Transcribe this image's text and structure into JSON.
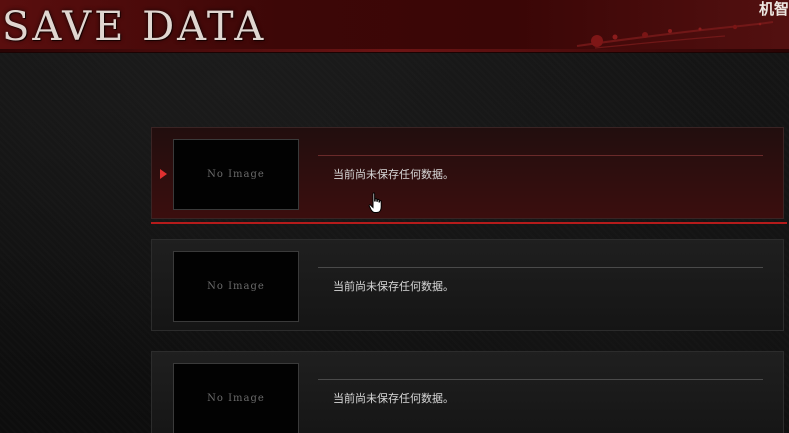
{
  "header": {
    "title": "SAVE DATA",
    "corner_text": "机智"
  },
  "slots": [
    {
      "thumbnail_label": "No Image",
      "status": "当前尚未保存任何数据。",
      "selected": true
    },
    {
      "thumbnail_label": "No Image",
      "status": "当前尚未保存任何数据。",
      "selected": false
    },
    {
      "thumbnail_label": "No Image",
      "status": "当前尚未保存任何数据。",
      "selected": false
    }
  ],
  "colors": {
    "header_red": "#4a0a0a",
    "selection_red": "#b51b1b",
    "arrow_red": "#e03030"
  },
  "icons": [
    "blood-splatter-icon",
    "selection-arrow-icon",
    "hand-cursor-icon"
  ]
}
